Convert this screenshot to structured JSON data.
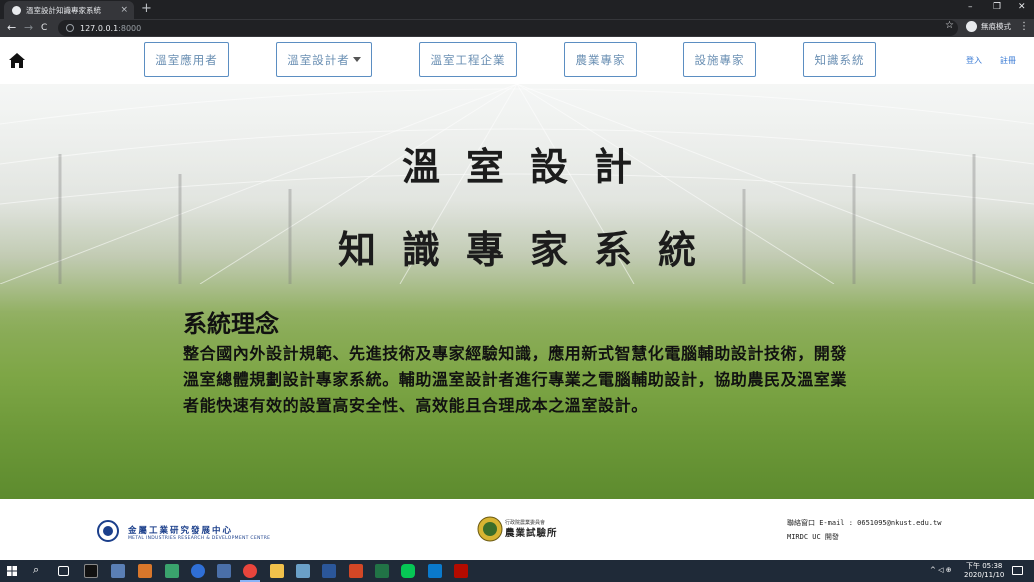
{
  "browser": {
    "tab_title": "溫室設計知識專家系統",
    "tab_close": "×",
    "new_tab": "+",
    "url_host": "127.0.0.1",
    "url_port": ":8000",
    "incognito_label": "無痕模式",
    "win_min": "–",
    "win_restore": "❐",
    "win_close": "✕",
    "back": "←",
    "forward": "→",
    "reload": "C",
    "star": "☆",
    "menu": "⋮"
  },
  "nav": {
    "items": [
      {
        "label": "溫室應用者"
      },
      {
        "label": "溫室設計者"
      },
      {
        "label": "溫室工程企業"
      },
      {
        "label": "農業專家"
      },
      {
        "label": "設施專家"
      },
      {
        "label": "知識系統"
      }
    ],
    "login": "登入",
    "register": "註冊"
  },
  "hero": {
    "title_line1": "溫室設計",
    "title_line2": "知識專家系統",
    "philosophy_heading": "系統理念",
    "philosophy_text": "整合國內外設計規範、先進技術及專家經驗知識，應用新式智慧化電腦輔助設計技術，開發溫室總體規劃設計專家系統。輔助溫室設計者進行專業之電腦輔助設計，協助農民及溫室業者能快速有效的設置高安全性、高效能且合理成本之溫室設計。"
  },
  "footer": {
    "mirdc_name": "金屬工業研究發展中心",
    "mirdc_en": "METAL INDUSTRIES RESEARCH & DEVELOPMENT CENTRE",
    "tari_sub": "行政院農業委員會",
    "tari_name": "農業試驗所",
    "contact_line": "聯絡窗口 E-mail : 0651095@nkust.edu.tw",
    "dev_line": "MIRDC UC 開發"
  },
  "taskbar": {
    "time": "下午 05:38",
    "date": "2020/11/10",
    "tray": "^ ◁ ⊕"
  },
  "colors": {
    "nav_border": "#5b8ec2",
    "nav_text": "#6a8fb3",
    "link": "#3a7bd5",
    "taskbar": "#1f2a38"
  }
}
